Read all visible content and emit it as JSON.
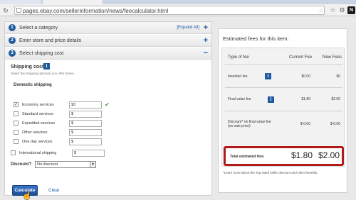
{
  "browser": {
    "url": "pages.ebay.com/sellerinformation/news/feecalculator.html",
    "ext_icon_glyph": "N"
  },
  "steps": [
    {
      "num": "1",
      "label": "Select a category",
      "sign": "+"
    },
    {
      "num": "2",
      "label": "Enter store and price details",
      "sign": "+"
    },
    {
      "num": "3",
      "label": "Select shipping cost",
      "sign": "−"
    }
  ],
  "expand_all": "[Expand All]",
  "shipping": {
    "title": "Shipping cost",
    "subtitle": "Select the shipping option(s) you offer below",
    "domestic_title": "Domestic shipping",
    "services": [
      {
        "label": "Economy services",
        "value": "$3",
        "checked": true
      },
      {
        "label": "Standard services",
        "value": "$",
        "checked": false
      },
      {
        "label": "Expedited services",
        "value": "$",
        "checked": false
      },
      {
        "label": "Other services",
        "value": "$",
        "checked": false
      },
      {
        "label": "One day services",
        "value": "$",
        "checked": false
      }
    ],
    "international": {
      "label": "International shipping",
      "value": "$",
      "checked": false
    }
  },
  "discount": {
    "label": "Discount?",
    "value": "No discount"
  },
  "actions": {
    "calculate": "Calculate",
    "clear": "Clear"
  },
  "fees": {
    "title": "Estimated fees for this item:",
    "headers": {
      "type": "Type of fee",
      "current": "Current Fee",
      "new": "New Fees"
    },
    "rows": [
      {
        "label": "Insertion fee",
        "current": "$0.00",
        "new": "$0"
      },
      {
        "label": "Final value fee",
        "current": "$1.80",
        "new": "$2.00"
      },
      {
        "label": "Discount* on final value fee",
        "label2": "(on sale price)",
        "current": "$-0.00",
        "new": "$-0.00"
      }
    ],
    "total": {
      "label": "Total estimated fees",
      "current": "$1.80",
      "new": "$2.00"
    },
    "note": "*Learn more about the Top-rated seller discount and other benefits."
  },
  "info_glyph": "i"
}
